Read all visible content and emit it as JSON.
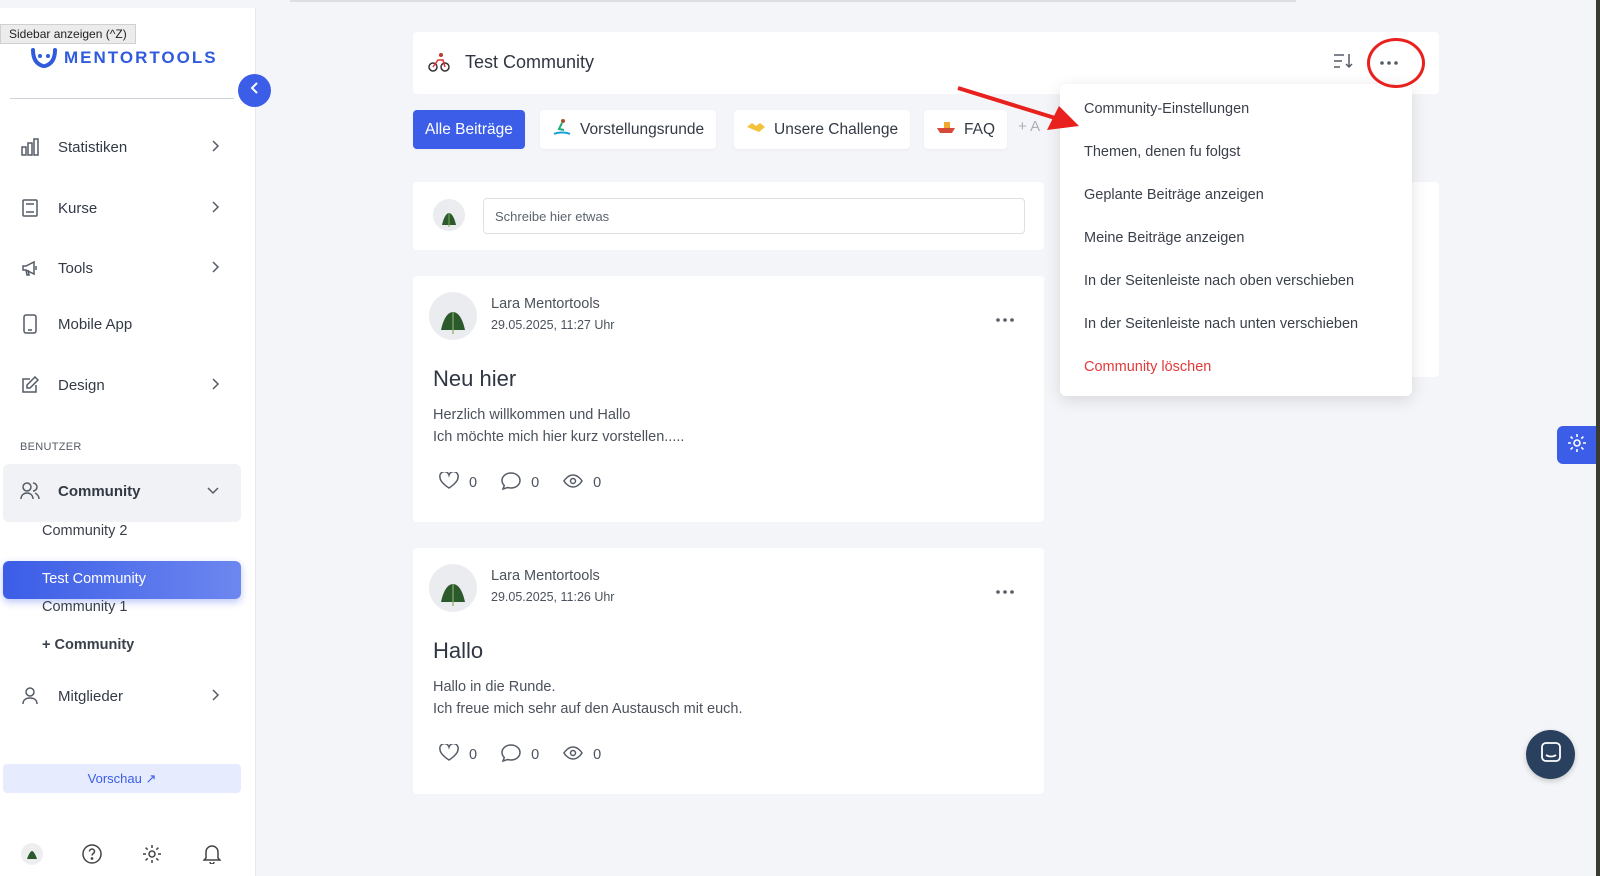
{
  "tooltip": "Sidebar anzeigen (^Z)",
  "sidebar": {
    "logo_text": "MENTORTOOLS",
    "items": [
      {
        "label": "Statistiken",
        "icon": "bar-chart-icon"
      },
      {
        "label": "Kurse",
        "icon": "book-icon"
      },
      {
        "label": "Tools",
        "icon": "megaphone-icon"
      },
      {
        "label": "Mobile App",
        "icon": "phone-icon"
      },
      {
        "label": "Design",
        "icon": "pencil-icon"
      }
    ],
    "section_label": "BENUTZER",
    "community": {
      "label": "Community",
      "subitems": [
        "Community 2",
        "Test Community",
        "Community 1",
        "+ Community"
      ],
      "active": "Test Community"
    },
    "members_label": "Mitglieder",
    "preview_label": "Vorschau ↗"
  },
  "header": {
    "title": "Test Community"
  },
  "tabs": [
    {
      "label": "Alle Beiträge",
      "active": true
    },
    {
      "label": "Vorstellungsrunde"
    },
    {
      "label": "Unsere Challenge"
    },
    {
      "label": "FAQ"
    }
  ],
  "tab_add_label": "+ A",
  "composer": {
    "placeholder": "Schreibe hier etwas"
  },
  "posts": [
    {
      "author": "Lara Mentortools",
      "date": "29.05.2025, 11:27 Uhr",
      "title": "Neu hier",
      "body_line1": "Herzlich willkommen und Hallo",
      "body_line2": "Ich möchte mich hier kurz vorstellen.....",
      "likes": "0",
      "comments": "0",
      "views": "0"
    },
    {
      "author": "Lara Mentortools",
      "date": "29.05.2025, 11:26 Uhr",
      "title": "Hallo",
      "body_line1": "Hallo in die Runde.",
      "body_line2": "Ich freue mich sehr auf den Austausch mit euch.",
      "likes": "0",
      "comments": "0",
      "views": "0"
    }
  ],
  "dropdown": {
    "items": [
      "Community-Einstellungen",
      "Themen, denen fu folgst",
      "Geplante Beiträge anzeigen",
      "Meine Beiträge anzeigen",
      "In der Seitenleiste nach oben verschieben",
      "In der Seitenleiste nach unten verschieben"
    ],
    "danger_item": "Community löschen"
  },
  "colors": {
    "accent": "#3b5de7",
    "danger": "#e03a3a",
    "annotation": "#e8201e"
  }
}
